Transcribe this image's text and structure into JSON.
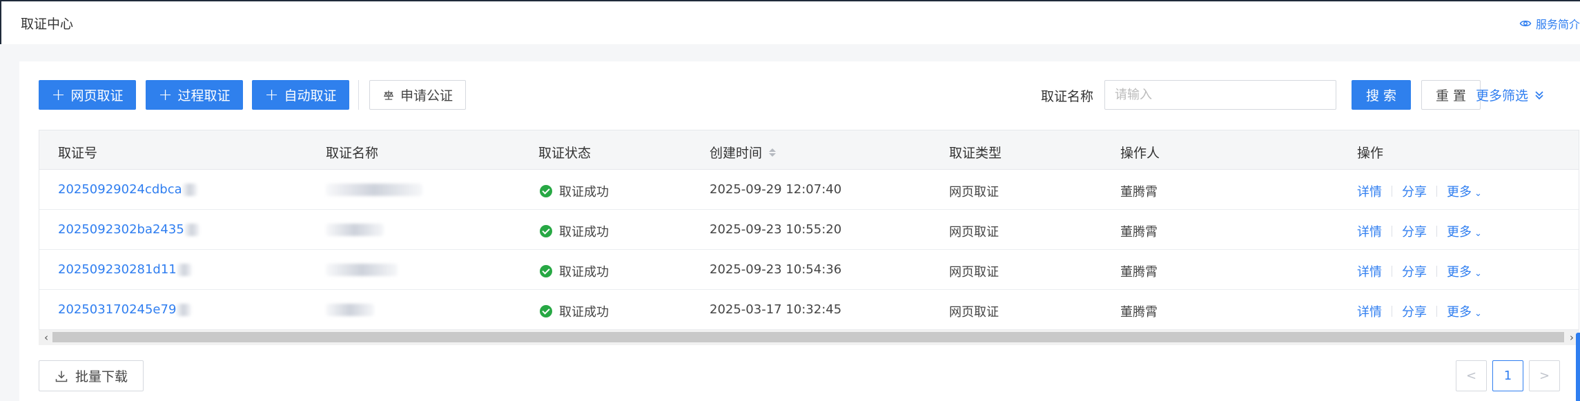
{
  "header": {
    "title": "取证中心",
    "service_link": "服务简介"
  },
  "toolbar": {
    "web_evidence": "网页取证",
    "process_evidence": "过程取证",
    "auto_evidence": "自动取证",
    "apply_notary": "申请公证",
    "filter_label": "取证名称",
    "filter_placeholder": "请输入",
    "search": "搜 索",
    "reset": "重 置",
    "more_filter": "更多筛选"
  },
  "table": {
    "columns": [
      "取证号",
      "取证名称",
      "取证状态",
      "创建时间",
      "取证类型",
      "操作人",
      "操作"
    ],
    "rows": [
      {
        "id": "20250929024cdbca",
        "status": "取证成功",
        "created": "2025-09-29 12:07:40",
        "type": "网页取证",
        "operator": "董腾霄"
      },
      {
        "id": "2025092302ba2435",
        "status": "取证成功",
        "created": "2025-09-23 10:55:20",
        "type": "网页取证",
        "operator": "董腾霄"
      },
      {
        "id": "20250923028​1d11",
        "status": "取证成功",
        "created": "2025-09-23 10:54:36",
        "type": "网页取证",
        "operator": "董腾霄"
      },
      {
        "id": "202503170245e79",
        "status": "取证成功",
        "created": "2025-03-17 10:32:45",
        "type": "网页取证",
        "operator": "董腾霄"
      }
    ],
    "ops": {
      "detail": "详情",
      "share": "分享",
      "more": "更多"
    }
  },
  "footer": {
    "batch_download": "批量下载",
    "prev": "<",
    "page": "1",
    "next": ">"
  },
  "colors": {
    "primary": "#2f80ed",
    "link": "#2f7ef0",
    "success": "#27a844"
  }
}
